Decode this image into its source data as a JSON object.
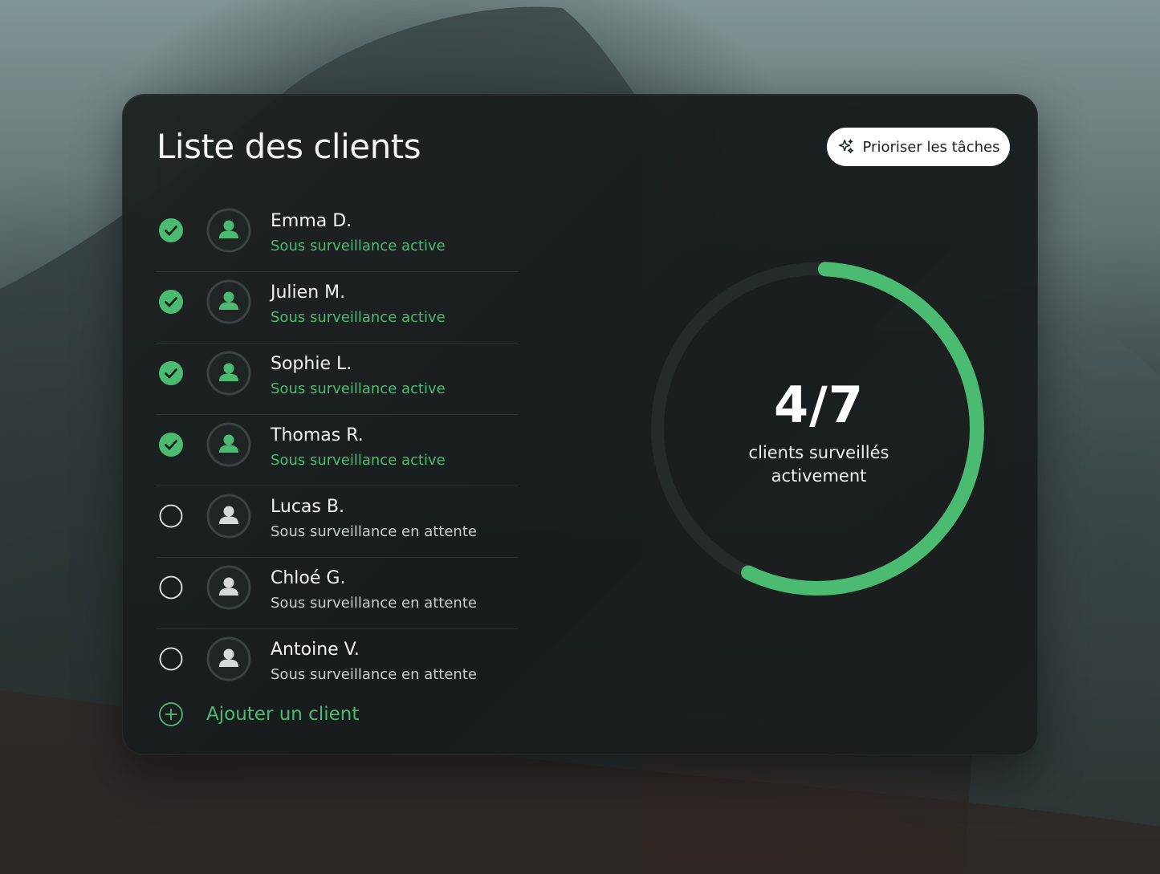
{
  "header": {
    "title": "Liste des clients",
    "prioritize_label": "Prioriser les tâches"
  },
  "clients": [
    {
      "name": "Emma D.",
      "status": "Sous surveillance active",
      "checked": true
    },
    {
      "name": "Julien M.",
      "status": "Sous surveillance active",
      "checked": true
    },
    {
      "name": "Sophie L.",
      "status": "Sous surveillance active",
      "checked": true
    },
    {
      "name": "Thomas R.",
      "status": "Sous surveillance active",
      "checked": true
    },
    {
      "name": "Lucas B.",
      "status": "Sous surveillance en attente",
      "checked": false
    },
    {
      "name": "Chloé G.",
      "status": "Sous surveillance en attente",
      "checked": false
    },
    {
      "name": "Antoine V.",
      "status": "Sous surveillance en attente",
      "checked": false
    }
  ],
  "add_client_label": "Ajouter un client",
  "summary": {
    "ratio": "4/7",
    "label_line1": "clients surveillés",
    "label_line2": "activement",
    "progress_fraction": 0.571
  },
  "colors": {
    "accent": "#4cbb72",
    "track": "#2a3131",
    "card_bg": "#1c2121"
  },
  "icons": {
    "prioritize": "sparkle-icon",
    "checked": "check-circle-icon",
    "unchecked": "empty-circle-icon",
    "avatar": "user-icon",
    "add": "plus-circle-icon"
  }
}
